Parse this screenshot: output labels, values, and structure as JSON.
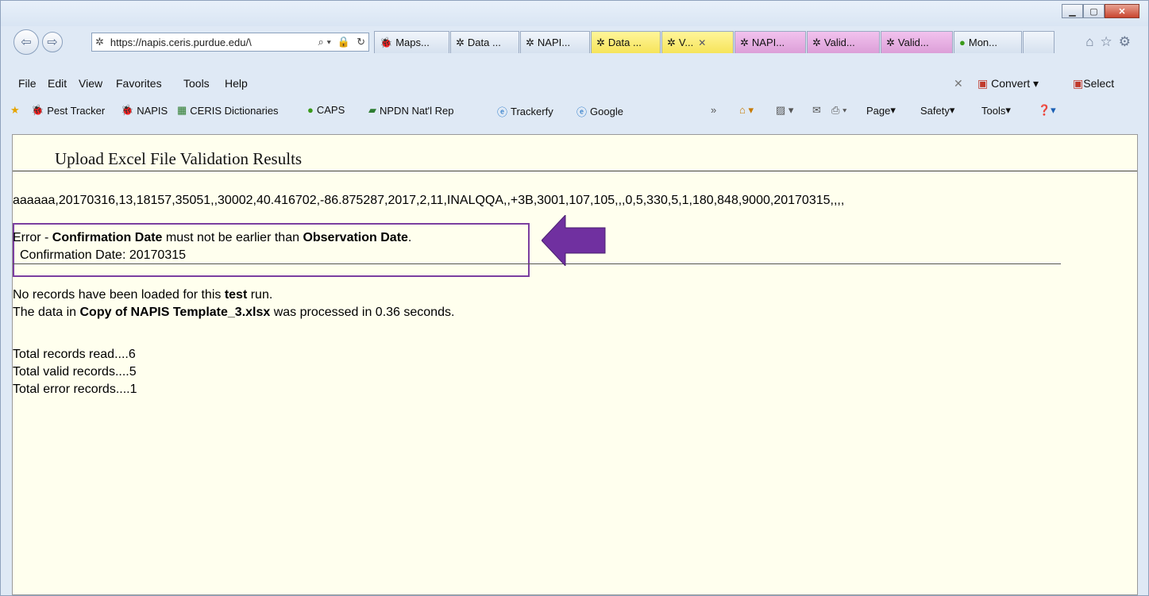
{
  "browser": {
    "address_url": "https://napis.ceris.purdue.edu/\\",
    "tabs": [
      {
        "label": "Maps...",
        "icon": "ladybug-icon",
        "color": "blue"
      },
      {
        "label": "Data ...",
        "icon": "ceris-icon",
        "color": "blue"
      },
      {
        "label": "NAPI...",
        "icon": "ceris-icon",
        "color": "blue"
      },
      {
        "label": "Data ...",
        "icon": "ceris-icon",
        "color": "yellow"
      },
      {
        "label": "V...",
        "icon": "ceris-icon",
        "color": "yellow",
        "active": true
      },
      {
        "label": "NAPI...",
        "icon": "ceris-icon",
        "color": "pink"
      },
      {
        "label": "Valid...",
        "icon": "ceris-icon",
        "color": "pink"
      },
      {
        "label": "Valid...",
        "icon": "ceris-icon",
        "color": "pink"
      },
      {
        "label": "Mon...",
        "icon": "leaf-icon",
        "color": "blue"
      }
    ],
    "menu": {
      "file": "File",
      "edit": "Edit",
      "view": "View",
      "favorites": "Favorites",
      "tools": "Tools",
      "help": "Help"
    },
    "menu_right": {
      "convert": "Convert",
      "select": "Select"
    },
    "favorites_bar": [
      {
        "label": "Pest Tracker",
        "icon": "ladybug-icon"
      },
      {
        "label": "NAPIS",
        "icon": "ladybug-icon"
      },
      {
        "label": "CERIS Dictionaries",
        "icon": "ceris-dict-icon"
      },
      {
        "label": "CAPS",
        "icon": "leaf-icon"
      },
      {
        "label": "NPDN Nat'l Rep",
        "icon": "flag-icon"
      },
      {
        "label": "Trackerfy",
        "icon": "ie-page-icon"
      },
      {
        "label": "Google",
        "icon": "ie-page-icon"
      }
    ],
    "command_bar": {
      "page": "Page",
      "safety": "Safety",
      "tools": "Tools"
    }
  },
  "page": {
    "title": "Upload Excel File Validation Results",
    "record_line": "aaaaaa,20170316,13,18157,35051,,30002,40.416702,-86.875287,2017,2,11,INALQQA,,+3B,3001,107,105,,,0,5,330,5,1,180,848,9000,20170315,,,,",
    "error": {
      "prefix": "Error - ",
      "field1": "Confirmation Date",
      "middle": " must not be earlier than ",
      "field2": "Observation Date",
      "suffix": ".",
      "detail": "Confirmation Date: 20170315"
    },
    "status": {
      "no_records_pre": "No records have been loaded for this ",
      "no_records_bold": "test",
      "no_records_post": " run.",
      "processed_pre": "The data in ",
      "processed_file": "Copy of NAPIS Template_3.xlsx",
      "processed_post": " was processed in 0.36 seconds."
    },
    "totals": {
      "read": "Total records read....6",
      "valid": "Total valid records....5",
      "error": "Total error records....1"
    }
  },
  "colors": {
    "content_bg": "#ffffee",
    "highlight_box": "#7b3fa0",
    "arrow": "#7030a0"
  }
}
